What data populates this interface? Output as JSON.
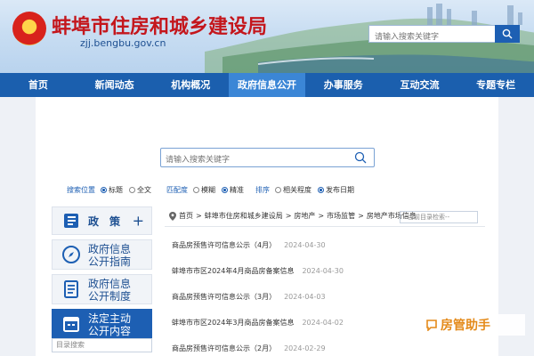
{
  "header": {
    "site_name": "蚌埠市住房和城乡建设局",
    "site_url": "zjj.bengbu.gov.cn",
    "search_placeholder": "请输入搜索关键字"
  },
  "nav": {
    "items": [
      {
        "label": "首页"
      },
      {
        "label": "新闻动态"
      },
      {
        "label": "机构概况"
      },
      {
        "label": "政府信息公开",
        "active": true
      },
      {
        "label": "办事服务"
      },
      {
        "label": "互动交流"
      },
      {
        "label": "专题专栏"
      }
    ]
  },
  "search": {
    "placeholder": "请输入搜索关键字"
  },
  "filters": {
    "position": {
      "label": "搜索位置",
      "options": [
        "标题",
        "全文"
      ],
      "selected": "标题"
    },
    "match": {
      "label": "匹配度",
      "options": [
        "模糊",
        "精准"
      ],
      "selected": "精准"
    },
    "sort": {
      "label": "排序",
      "options": [
        "相关程度",
        "发布日期"
      ],
      "selected": "发布日期"
    }
  },
  "sidebar": {
    "items": [
      {
        "label_1": "政　策",
        "label_2": "",
        "icon": "book-icon"
      },
      {
        "label_1": "政府信息",
        "label_2": "公开指南",
        "icon": "compass-icon"
      },
      {
        "label_1": "政府信息",
        "label_2": "公开制度",
        "icon": "document-list-icon"
      },
      {
        "label_1": "法定主动",
        "label_2": "公开内容",
        "icon": "calendar-icon"
      }
    ],
    "search_placeholder": "目录搜索"
  },
  "breadcrumb": {
    "items": [
      "首页",
      "蚌埠市住房和城乡建设局",
      "房地产",
      "市场监管",
      "房地产市场信息"
    ],
    "search_placeholder": "--当前目录检索--"
  },
  "list": [
    {
      "title": "商品房预售许可信息公示（4月）",
      "date": "2024-04-30"
    },
    {
      "title": "蚌埠市市区2024年4月商品房备案信息",
      "date": "2024-04-30"
    },
    {
      "title": "商品房预售许可信息公示（3月）",
      "date": "2024-04-03"
    },
    {
      "title": "蚌埠市市区2024年3月商品房备案信息",
      "date": "2024-04-02"
    },
    {
      "title": "商品房预售许可信息公示（2月）",
      "date": "2024-02-29"
    }
  ],
  "watermark": {
    "text": "房管助手"
  },
  "colors": {
    "primary": "#1b5fae",
    "active_nav": "#3b86d6",
    "title_red": "#c4161c"
  }
}
